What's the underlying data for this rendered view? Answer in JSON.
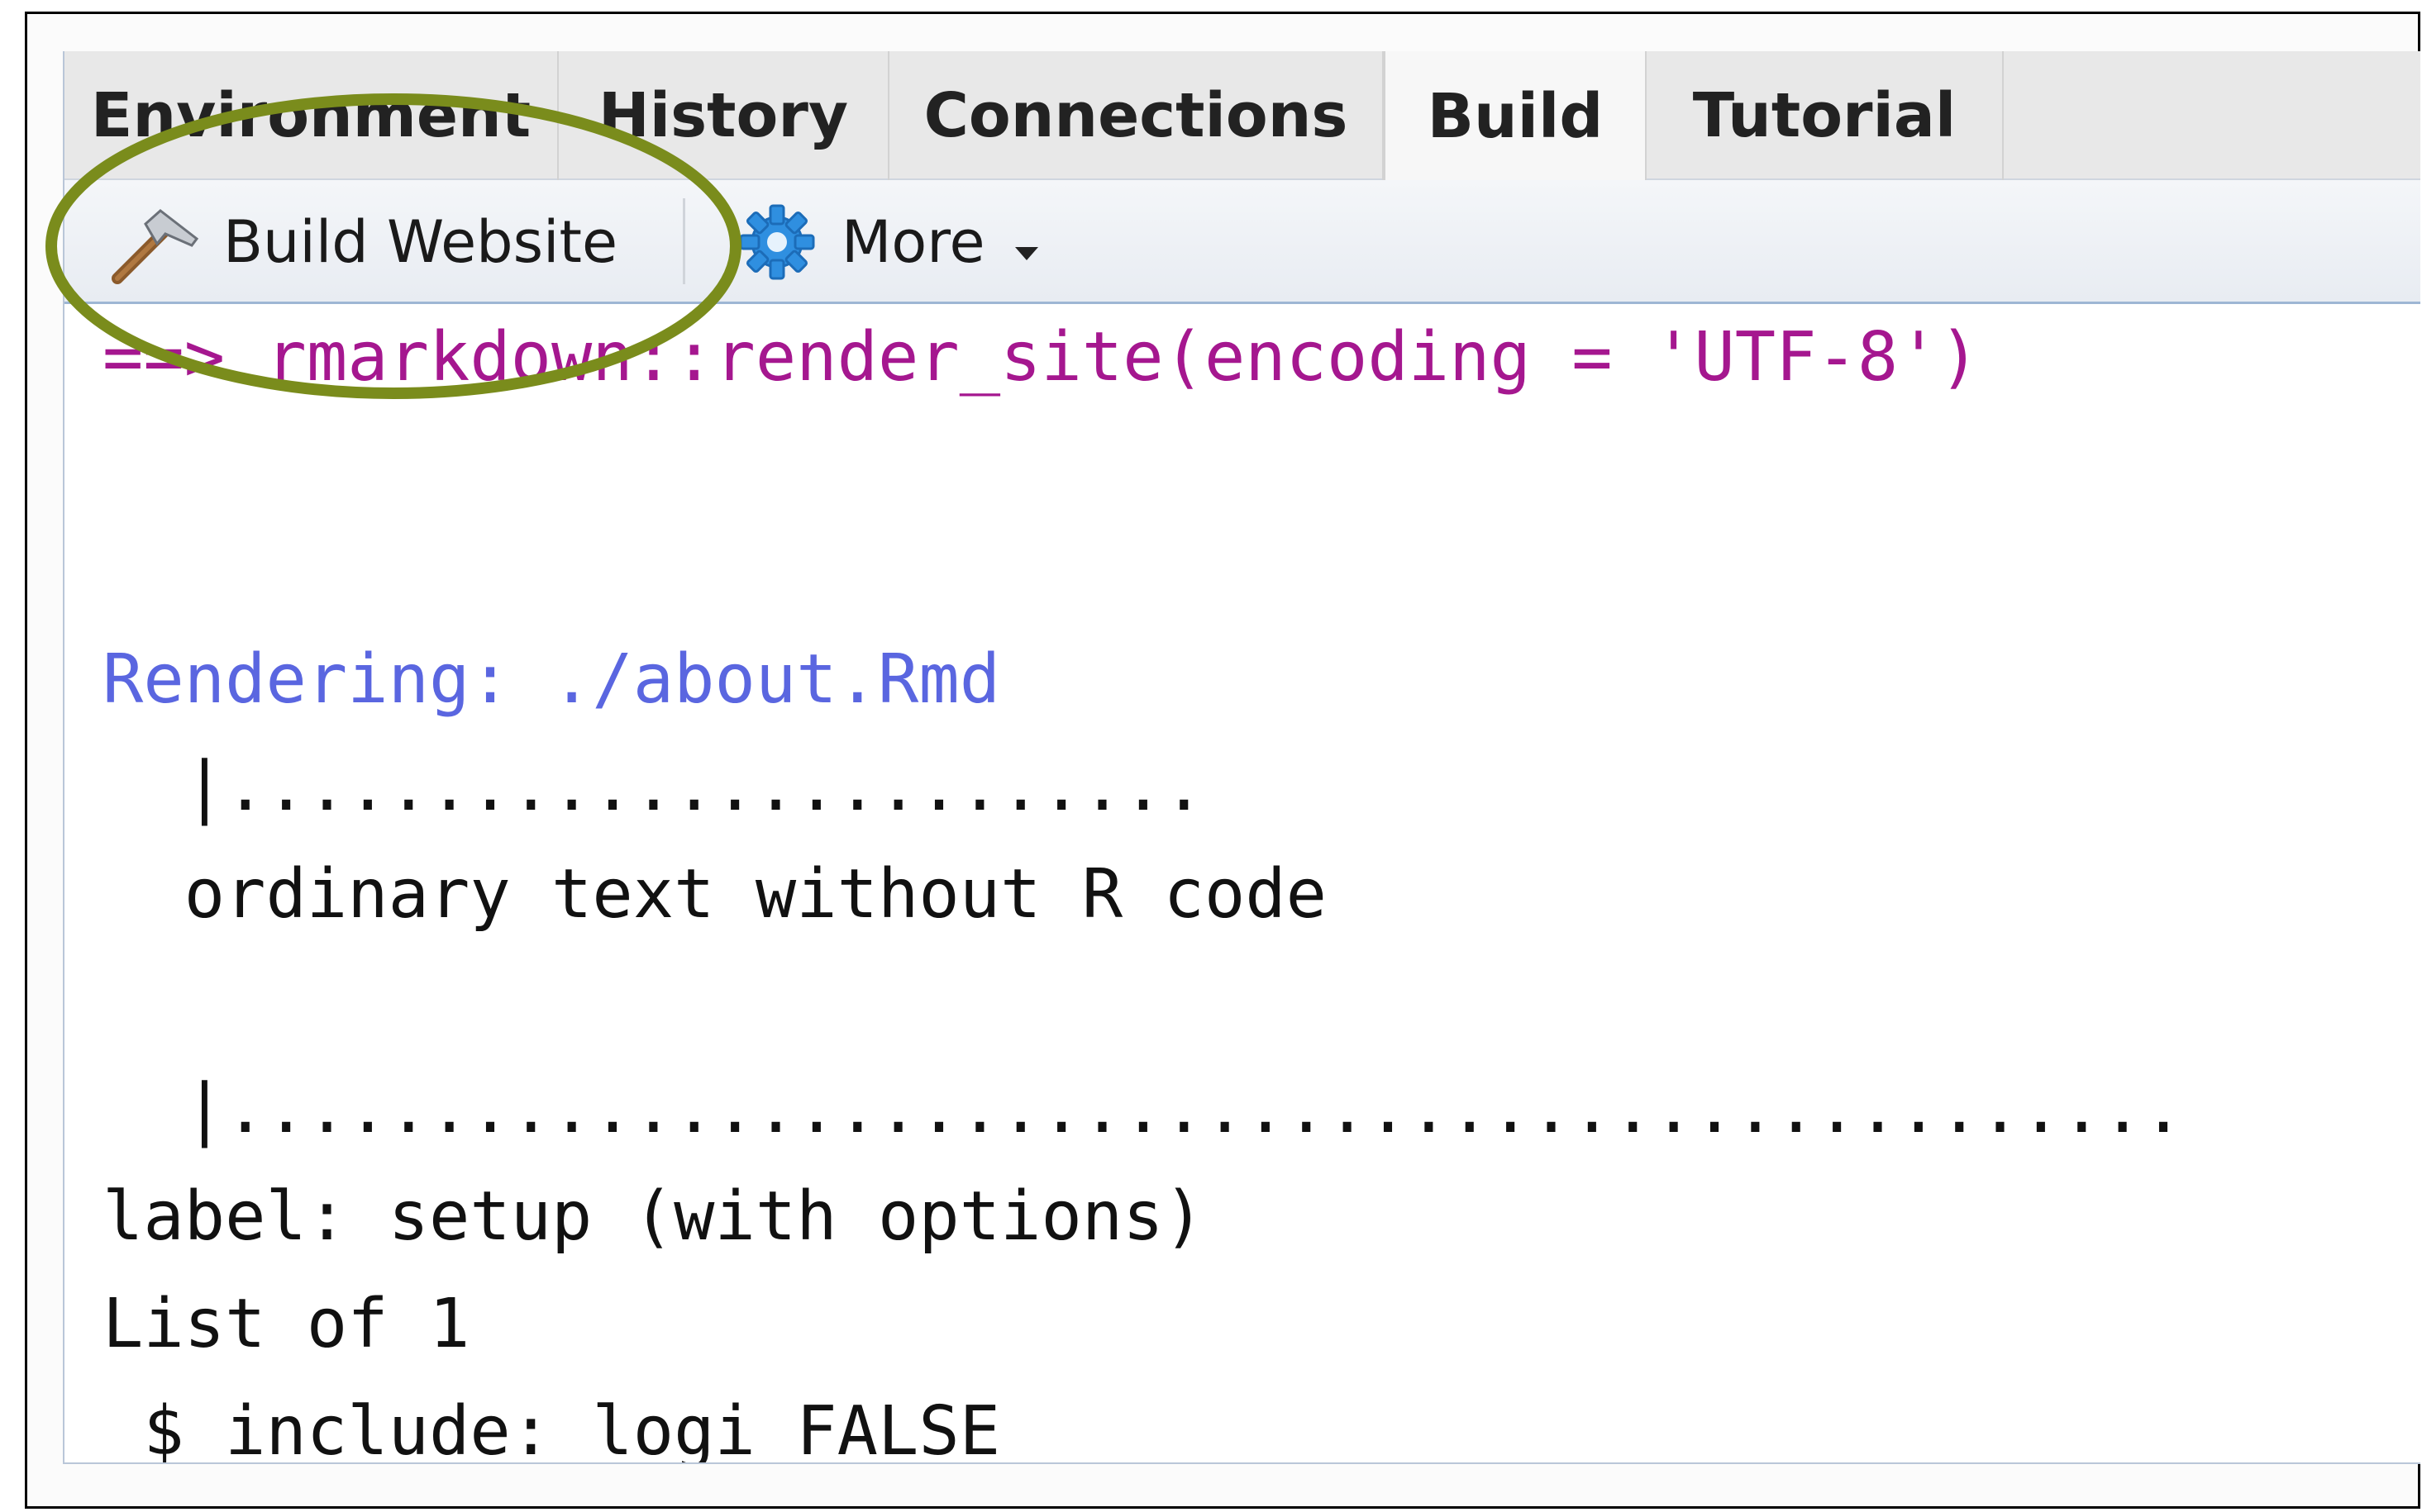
{
  "tabs": [
    "Environment",
    "History",
    "Connections",
    "Build",
    "Tutorial"
  ],
  "active_tab": "Build",
  "toolbar": {
    "build_label": "Build Website",
    "more_label": "More",
    "hammer_icon": "hammer-icon",
    "gear_icon": "gear-icon",
    "dropdown_icon": "caret-down-icon"
  },
  "console": {
    "lines": [
      "==> rmarkdown::render_site(encoding = 'UTF-8')",
      "",
      "",
      "Rendering: ./about.Rmd",
      "  |........................",
      "  ordinary text without R code",
      "",
      "  |................................................",
      "label: setup (with options)",
      "List of 1",
      " $ include: logi FALSE"
    ]
  },
  "colors": {
    "command": "#a5178f",
    "info": "#5a66e0",
    "annotation": "#7a8c1c"
  }
}
